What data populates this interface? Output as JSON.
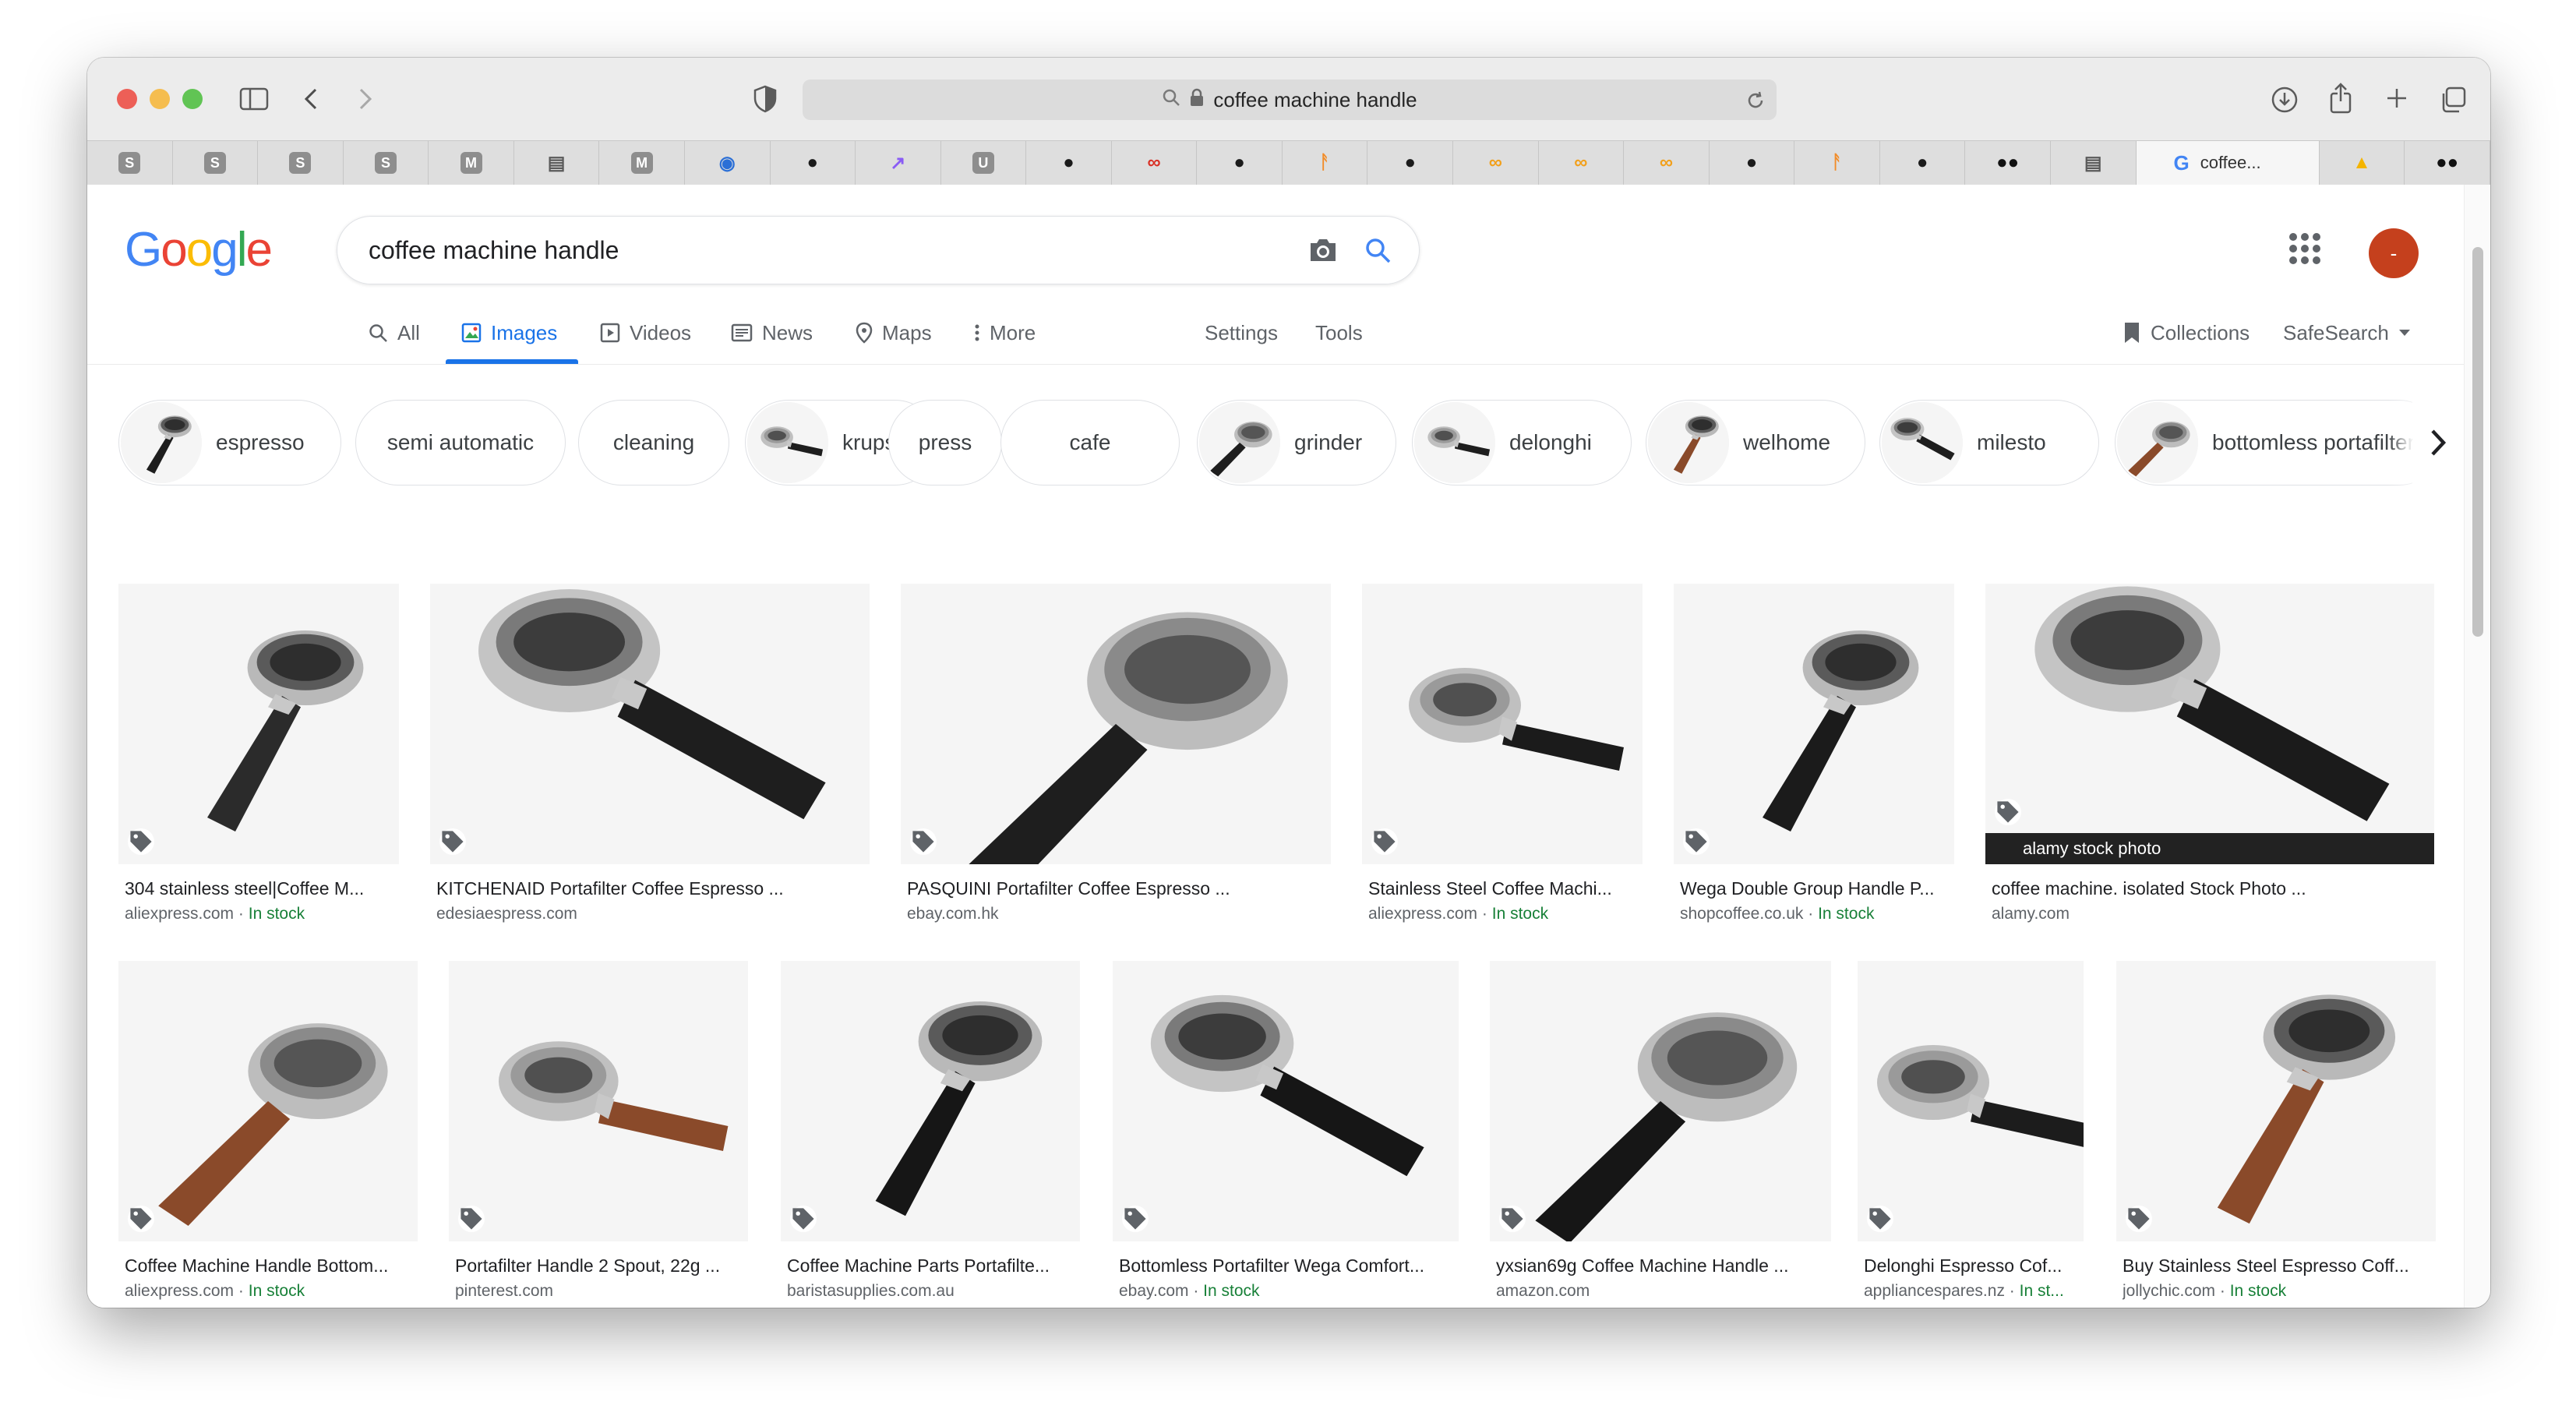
{
  "browser": {
    "address": "coffee machine handle",
    "tabs": [
      {
        "icon": "s-badge-icon",
        "letter": "S",
        "color": "#8e8e8e"
      },
      {
        "icon": "s-badge-icon",
        "letter": "S",
        "color": "#8e8e8e"
      },
      {
        "icon": "s-badge-icon",
        "letter": "S",
        "color": "#8e8e8e"
      },
      {
        "icon": "s-badge-icon",
        "letter": "S",
        "color": "#8e8e8e"
      },
      {
        "icon": "m-badge-icon",
        "letter": "M",
        "color": "#8e8e8e"
      },
      {
        "icon": "reader-icon",
        "letter": "▤",
        "color": "#5a5a5a"
      },
      {
        "icon": "m-badge-icon",
        "letter": "M",
        "color": "#8e8e8e"
      },
      {
        "icon": "record-icon",
        "letter": "◉",
        "color": "#2b6fd6"
      },
      {
        "icon": "github-icon",
        "letter": "●",
        "color": "#1b1b1b"
      },
      {
        "icon": "chart-icon",
        "letter": "↗",
        "color": "#8a5cf5"
      },
      {
        "icon": "u-badge-icon",
        "letter": "U",
        "color": "#8e8e8e"
      },
      {
        "icon": "github-icon",
        "letter": "●",
        "color": "#1b1b1b"
      },
      {
        "icon": "infinity-red-icon",
        "letter": "∞",
        "color": "#d93025"
      },
      {
        "icon": "github-icon",
        "letter": "●",
        "color": "#1b1b1b"
      },
      {
        "icon": "fire-icon",
        "letter": "ᚨ",
        "color": "#f28c28"
      },
      {
        "icon": "github-icon",
        "letter": "●",
        "color": "#1b1b1b"
      },
      {
        "icon": "infinity-orange-icon",
        "letter": "∞",
        "color": "#f2a01b"
      },
      {
        "icon": "infinity-orange-icon",
        "letter": "∞",
        "color": "#f2a01b"
      },
      {
        "icon": "infinity-orange-icon",
        "letter": "∞",
        "color": "#f2a01b"
      },
      {
        "icon": "github-icon",
        "letter": "●",
        "color": "#1b1b1b"
      },
      {
        "icon": "fire-icon",
        "letter": "ᚨ",
        "color": "#f28c28"
      },
      {
        "icon": "github-icon",
        "letter": "●",
        "color": "#1b1b1b"
      },
      {
        "icon": "medium-icon",
        "letter": "●●",
        "color": "#111111"
      },
      {
        "icon": "reader-icon",
        "letter": "▤",
        "color": "#5a5a5a"
      }
    ],
    "active_tab": {
      "title": "coffee...",
      "icon": "google-g-icon"
    },
    "after_tabs": [
      {
        "icon": "google-drive-icon",
        "letter": "▲",
        "color": "#f4b400"
      },
      {
        "icon": "medium-icon",
        "letter": "●●",
        "color": "#111111"
      }
    ]
  },
  "google": {
    "logo_letters": [
      {
        "ch": "G",
        "color": "#4285f4"
      },
      {
        "ch": "o",
        "color": "#ea4335"
      },
      {
        "ch": "o",
        "color": "#fbbc05"
      },
      {
        "ch": "g",
        "color": "#4285f4"
      },
      {
        "ch": "l",
        "color": "#34a853"
      },
      {
        "ch": "e",
        "color": "#ea4335"
      }
    ],
    "query": "coffee machine handle",
    "avatar_letter": "-",
    "accent": "#1a73e8"
  },
  "nav": {
    "all": "All",
    "images": "Images",
    "videos": "Videos",
    "news": "News",
    "maps": "Maps",
    "more": "More",
    "settings": "Settings",
    "tools": "Tools",
    "collections": "Collections",
    "safesearch": "SafeSearch"
  },
  "chips": [
    {
      "label": "espresso",
      "thumb": true
    },
    {
      "label": "semi automatic",
      "thumb": false
    },
    {
      "label": "cleaning",
      "thumb": false
    },
    {
      "label": "krups",
      "thumb": true
    },
    {
      "label": "press",
      "thumb": false
    },
    {
      "label": "cafe",
      "thumb": false
    },
    {
      "label": "grinder",
      "thumb": true
    },
    {
      "label": "delonghi",
      "thumb": true
    },
    {
      "label": "welhome",
      "thumb": true
    },
    {
      "label": "milesto",
      "thumb": true
    },
    {
      "label": "bottomless portafilter",
      "thumb": true
    }
  ],
  "results_row1": [
    {
      "title": "304 stainless steel|Coffee M...",
      "source": "aliexpress.com",
      "stock": "In stock",
      "handle": "#2b2b2b"
    },
    {
      "title": "KITCHENAID Portafilter Coffee Espresso ...",
      "source": "edesiaespress.com",
      "stock": "",
      "handle": "#1e1e1e"
    },
    {
      "title": "PASQUINI Portafilter Coffee Espresso ...",
      "source": "ebay.com.hk",
      "stock": "",
      "handle": "#1e1e1e"
    },
    {
      "title": "Stainless Steel Coffee Machi...",
      "source": "aliexpress.com",
      "stock": "In stock",
      "handle": "#1b1b1b"
    },
    {
      "title": "Wega Double Group Handle P...",
      "source": "shopcoffee.co.uk",
      "stock": "In stock",
      "handle": "#1b1b1b"
    },
    {
      "title": "coffee machine. isolated Stock Photo ...",
      "source": "alamy.com",
      "stock": "",
      "handle": "#1b1b1b",
      "overlay": "alamy stock photo"
    }
  ],
  "results_row2": [
    {
      "title": "Coffee Machine Handle Bottom...",
      "source": "aliexpress.com",
      "stock": "In stock",
      "handle": "#8a4a2a"
    },
    {
      "title": "Portafilter Handle 2 Spout, 22g ...",
      "source": "pinterest.com",
      "stock": "",
      "handle": "#8a4a2a"
    },
    {
      "title": "Coffee Machine Parts Portafilte...",
      "source": "baristasupplies.com.au",
      "stock": "",
      "handle": "#161616"
    },
    {
      "title": "Bottomless Portafilter Wega Comfort...",
      "source": "ebay.com",
      "stock": "In stock",
      "handle": "#161616"
    },
    {
      "title": "yxsian69g Coffee Machine Handle ...",
      "source": "amazon.com",
      "stock": "",
      "handle": "#161616"
    },
    {
      "title": "Delonghi Espresso Cof...",
      "source": "appliancespares.nz",
      "stock": "In st...",
      "handle": "#1c1c1c"
    },
    {
      "title": "Buy Stainless Steel Espresso Coff...",
      "source": "jollychic.com",
      "stock": "In stock",
      "handle": "#8a4a2a"
    }
  ],
  "colors": {
    "stock_green": "#188038",
    "link_gray": "#5f6368"
  }
}
